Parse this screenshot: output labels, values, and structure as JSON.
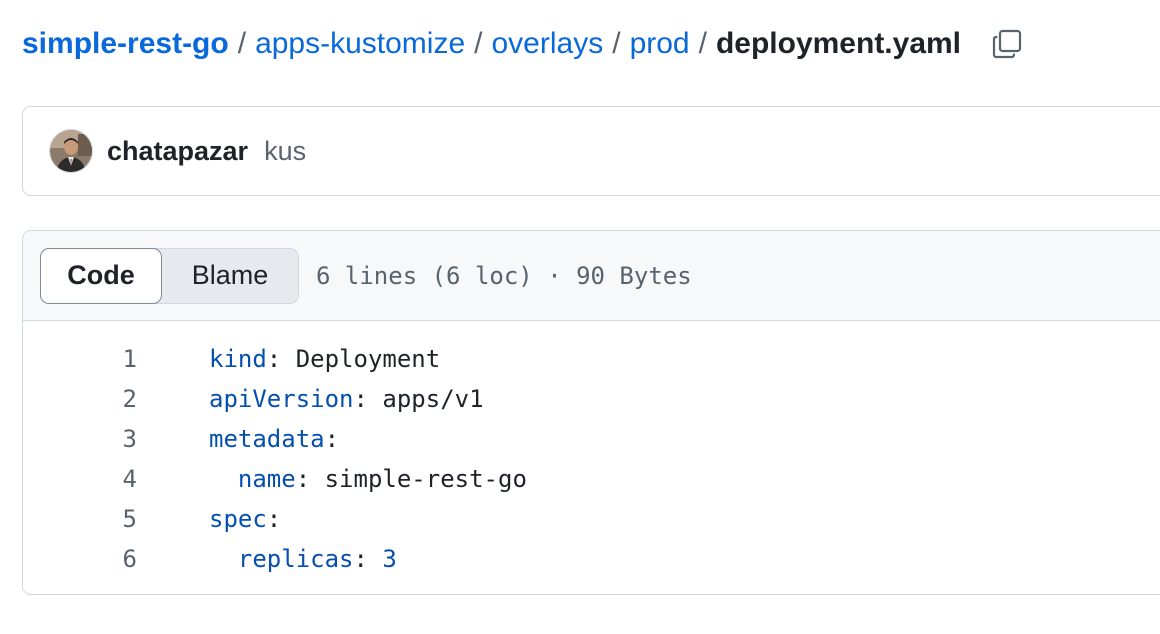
{
  "breadcrumb": {
    "repo": "simple-rest-go",
    "path": [
      "apps-kustomize",
      "overlays",
      "prod"
    ],
    "file": "deployment.yaml",
    "separator": "/"
  },
  "commit": {
    "author": "chatapazar",
    "message": "kus"
  },
  "file_view": {
    "tabs": [
      "Code",
      "Blame"
    ],
    "meta": "6 lines (6 loc) · 90 Bytes"
  },
  "code": [
    {
      "num": "1",
      "indent": "",
      "key": "kind",
      "sep": ": ",
      "value": "Deployment",
      "type": "str"
    },
    {
      "num": "2",
      "indent": "",
      "key": "apiVersion",
      "sep": ": ",
      "value": "apps/v1",
      "type": "str"
    },
    {
      "num": "3",
      "indent": "",
      "key": "metadata",
      "sep": ":",
      "value": "",
      "type": "str"
    },
    {
      "num": "4",
      "indent": "  ",
      "key": "name",
      "sep": ": ",
      "value": "simple-rest-go",
      "type": "str"
    },
    {
      "num": "5",
      "indent": "",
      "key": "spec",
      "sep": ":",
      "value": "",
      "type": "str"
    },
    {
      "num": "6",
      "indent": "  ",
      "key": "replicas",
      "sep": ": ",
      "value": "3",
      "type": "num"
    }
  ],
  "icons": {
    "copy": "copy-icon",
    "avatar": "avatar"
  },
  "colors": {
    "link": "#0969da",
    "border": "#d1d9e0",
    "muted": "#59636e",
    "key": "#0550ae"
  }
}
